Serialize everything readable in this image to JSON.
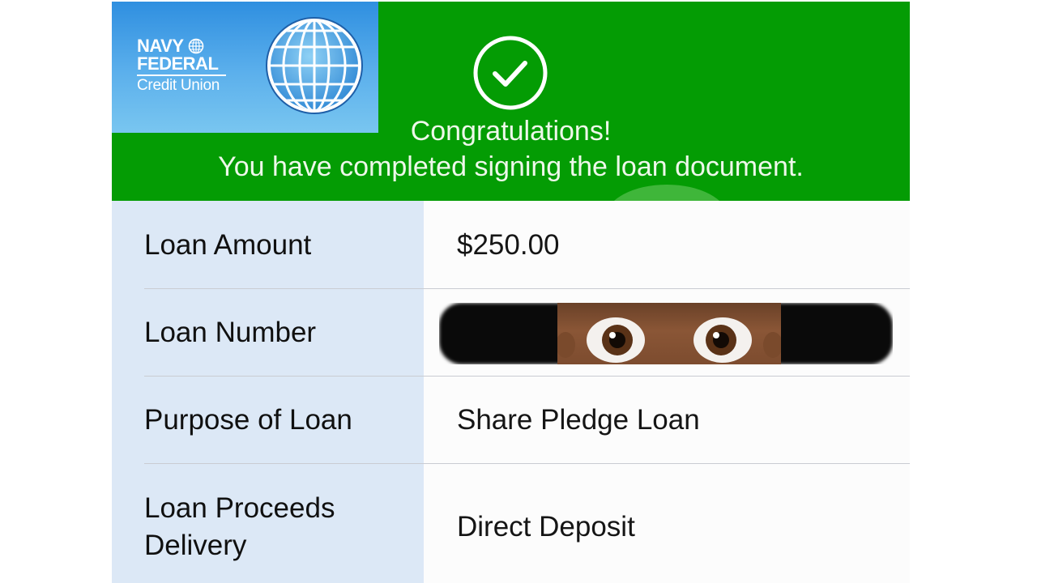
{
  "brand": {
    "name_line1": "NAVY",
    "name_line2": "FEDERAL",
    "name_line3": "Credit Union",
    "logo_icon": "globe-icon"
  },
  "banner": {
    "status_icon": "checkmark-circle-icon",
    "title": "Congratulations!",
    "subtitle": "You have completed signing the loan document.",
    "color": "#049c04"
  },
  "details": [
    {
      "label": "Loan Amount",
      "value": "$250.00"
    },
    {
      "label": "Loan Number",
      "value": "",
      "redacted": true
    },
    {
      "label": "Purpose of Loan",
      "value": "Share Pledge Loan"
    },
    {
      "label": "Loan Proceeds Delivery",
      "value": "Direct Deposit"
    }
  ],
  "colors": {
    "label_column": "#dce8f6",
    "value_column": "#fcfcfc",
    "brand_panel": "#2f8fe0"
  }
}
